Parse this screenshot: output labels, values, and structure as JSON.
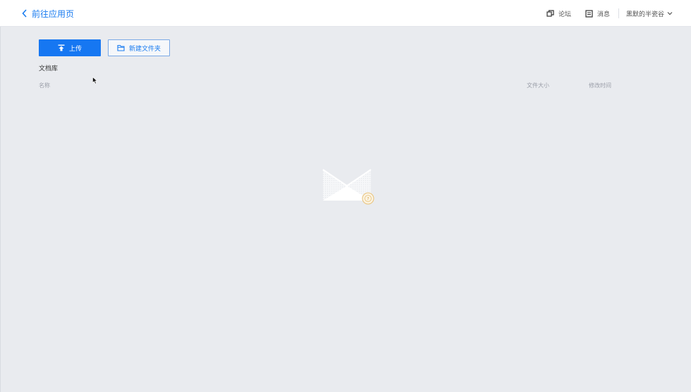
{
  "header": {
    "back_label": "前往应用页",
    "forum_label": "论坛",
    "messages_label": "消息",
    "user_name": "黑默的半瓷谷"
  },
  "toolbar": {
    "upload_label": "上传",
    "new_folder_label": "新建文件夹"
  },
  "library": {
    "title": "文档库",
    "columns": {
      "name": "名称",
      "size": "文件大小",
      "modified": "修改时间"
    }
  },
  "colors": {
    "accent": "#1677f2",
    "background": "#e9ebef",
    "header_bg": "#ffffff"
  },
  "icons": [
    "chevron-left-icon",
    "forum-icon",
    "message-icon",
    "chevron-down-icon",
    "upload-icon",
    "folder-icon",
    "empty-envelope-icon"
  ]
}
